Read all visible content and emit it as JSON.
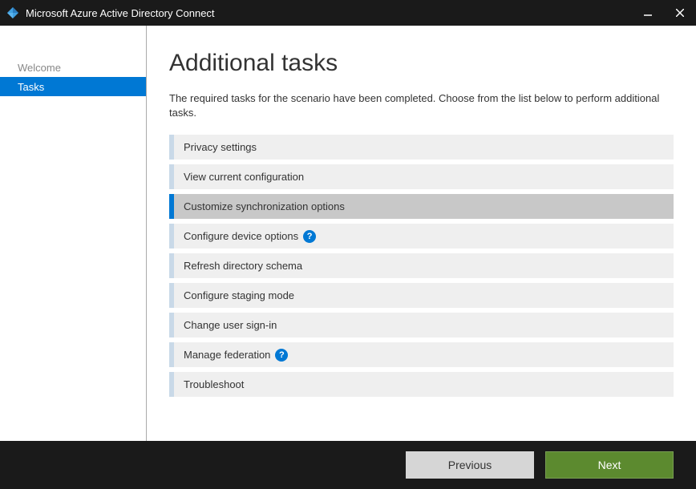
{
  "window": {
    "title": "Microsoft Azure Active Directory Connect"
  },
  "sidebar": {
    "items": [
      {
        "label": "Welcome",
        "active": false
      },
      {
        "label": "Tasks",
        "active": true
      }
    ]
  },
  "main": {
    "heading": "Additional tasks",
    "description": "The required tasks for the scenario have been completed. Choose from the list below to perform additional tasks.",
    "tasks": [
      {
        "label": "Privacy settings",
        "selected": false,
        "help": false
      },
      {
        "label": "View current configuration",
        "selected": false,
        "help": false
      },
      {
        "label": "Customize synchronization options",
        "selected": true,
        "help": false
      },
      {
        "label": "Configure device options",
        "selected": false,
        "help": true
      },
      {
        "label": "Refresh directory schema",
        "selected": false,
        "help": false
      },
      {
        "label": "Configure staging mode",
        "selected": false,
        "help": false
      },
      {
        "label": "Change user sign-in",
        "selected": false,
        "help": false
      },
      {
        "label": "Manage federation",
        "selected": false,
        "help": true
      },
      {
        "label": "Troubleshoot",
        "selected": false,
        "help": false
      }
    ]
  },
  "footer": {
    "previous": "Previous",
    "next": "Next"
  },
  "help_glyph": "?"
}
